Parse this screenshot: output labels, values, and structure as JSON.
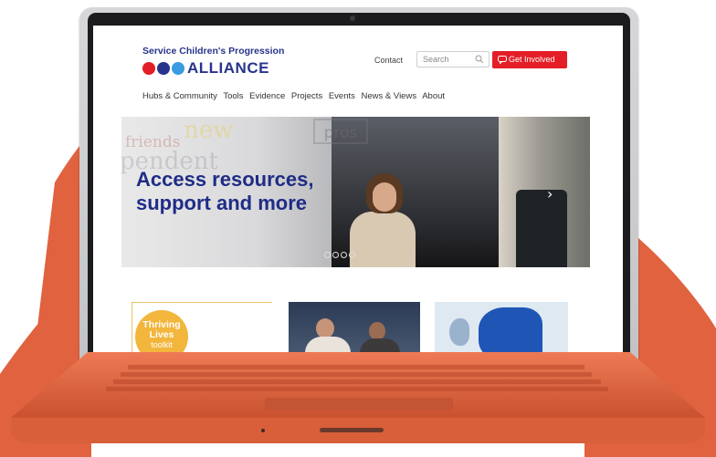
{
  "site": {
    "logo_line1": "Service Children's Progression",
    "logo_line2": "ALLIANCE",
    "logo_dot_colors": [
      "#e41e26",
      "#27348b",
      "#3a9be0"
    ],
    "brand_color": "#27348b",
    "accent_color": "#e41e26",
    "background_shape_color": "#e0623f"
  },
  "header": {
    "contact_label": "Contact",
    "search_placeholder": "Search",
    "search_icon": "search-icon",
    "cta_label": "Get Involved",
    "cta_icon": "chat-icon"
  },
  "nav": {
    "items": [
      "Hubs & Community",
      "Tools",
      "Evidence",
      "Projects",
      "Events",
      "News & Views",
      "About"
    ]
  },
  "hero": {
    "title_line1": "Access resources,",
    "title_line2": "support and more",
    "next_icon": "chevron-right-icon",
    "slide_count": 4,
    "background_words": [
      "friends",
      "new",
      "pendent",
      "pros"
    ]
  },
  "cards": [
    {
      "badge_line1": "Thriving",
      "badge_line2": "Lives",
      "badge_line3": "toolkit"
    },
    {
      "image": "group-photo"
    },
    {
      "image": "map-image"
    }
  ]
}
